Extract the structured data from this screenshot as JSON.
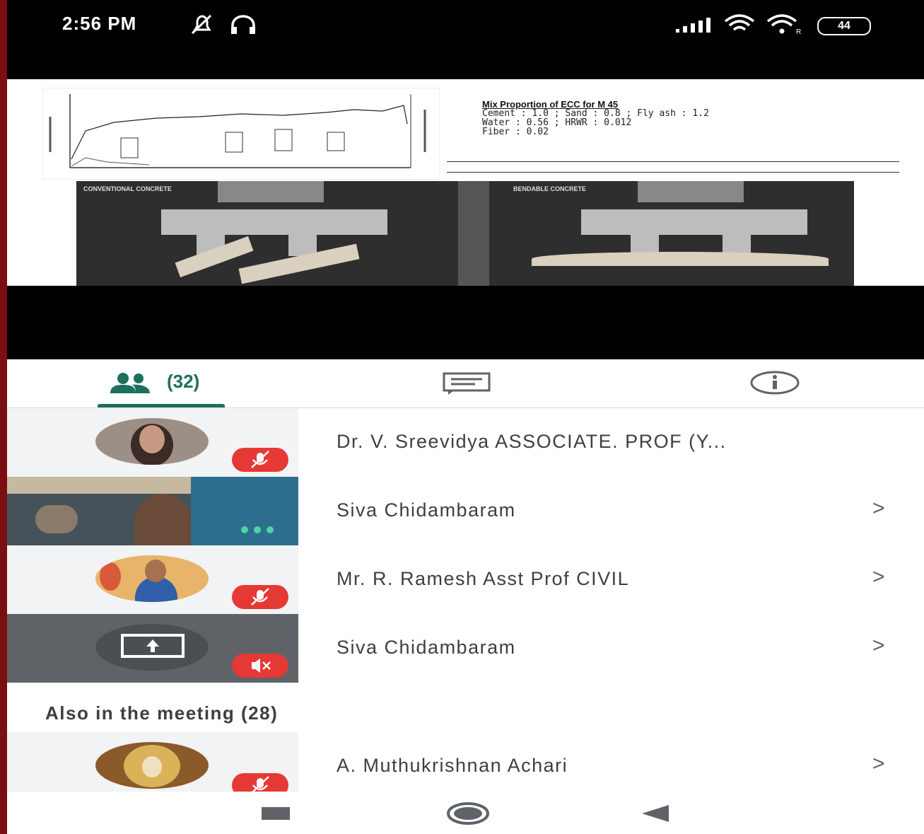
{
  "status_bar": {
    "time": "2:56 PM",
    "battery": "44",
    "icons": [
      "mute-bell-icon",
      "headset-icon",
      "signal-icon",
      "wifi-icon",
      "wifi-icon",
      "battery-icon"
    ]
  },
  "slide": {
    "mix_title": "Mix Proportion of ECC for M 45",
    "mix_lines": [
      "Cement : 1.0 ; Sand : 0.8 ;  Fly ash : 1.2",
      "Water : 0.56 ; HRWR : 0.012",
      "Fiber : 0.02"
    ],
    "photo_left_label": "CONVENTIONAL CONCRETE",
    "photo_right_label": "BENDABLE CONCRETE"
  },
  "tabs": {
    "people_count": "(32)",
    "icons": [
      "people-icon",
      "chat-icon",
      "info-icon"
    ]
  },
  "participants": [
    {
      "name": "Dr. V. Sreevidya ASSOCIATE. PROF (Y...",
      "chevron": ""
    },
    {
      "name": "Siva Chidambaram",
      "chevron": ">"
    },
    {
      "name": "Mr. R. Ramesh Asst Prof CIVIL",
      "chevron": ">"
    },
    {
      "name": "Siva Chidambaram",
      "chevron": ">"
    }
  ],
  "also_in_meeting": "Also in the meeting (28)",
  "extra_participants": [
    {
      "name": "A. Muthukrishnan Achari",
      "chevron": ">"
    }
  ],
  "colors": {
    "accent": "#1e6f5c",
    "mute_red": "#e53935",
    "frame": "#7a0f12"
  }
}
